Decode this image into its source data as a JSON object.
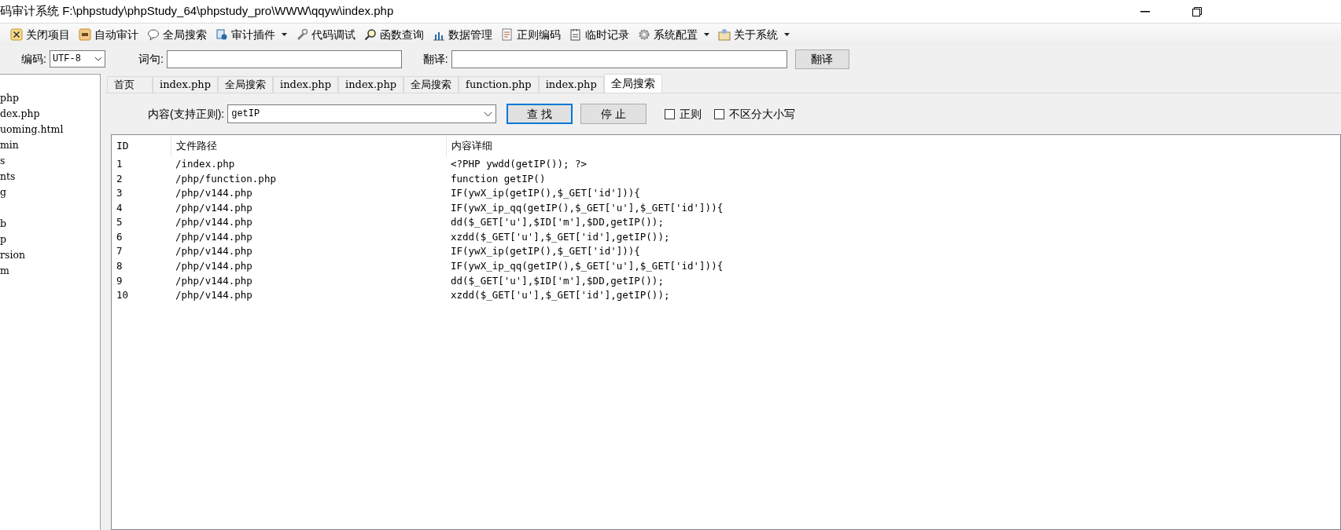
{
  "window": {
    "title": "码审计系统  F:\\phpstudy\\phpStudy_64\\phpstudy_pro\\WWW\\qqyw\\index.php"
  },
  "toolbar": [
    {
      "label": "关闭项目",
      "dropdown": false
    },
    {
      "label": "自动审计",
      "dropdown": false
    },
    {
      "label": "全局搜索",
      "dropdown": false
    },
    {
      "label": "审计插件",
      "dropdown": true
    },
    {
      "label": "代码调试",
      "dropdown": false
    },
    {
      "label": "函数查询",
      "dropdown": false
    },
    {
      "label": "数据管理",
      "dropdown": false
    },
    {
      "label": "正则编码",
      "dropdown": false
    },
    {
      "label": "临时记录",
      "dropdown": false
    },
    {
      "label": "系统配置",
      "dropdown": true
    },
    {
      "label": "关于系统",
      "dropdown": true
    }
  ],
  "fields_row": {
    "encoding_label": "编码:",
    "encoding_value": "UTF-8",
    "phrase_label": "词句:",
    "translate_label": "翻译:",
    "translate_button": "翻译"
  },
  "tree": {
    "items": [
      "php",
      "dex.php",
      "uoming.html",
      "min",
      "s",
      "nts",
      "g",
      "b",
      "p",
      "rsion",
      "m"
    ]
  },
  "tabs": [
    {
      "label": "首页",
      "selected": false
    },
    {
      "label": "index.php",
      "selected": false
    },
    {
      "label": "全局搜索",
      "selected": false
    },
    {
      "label": "index.php",
      "selected": false
    },
    {
      "label": "index.php",
      "selected": false
    },
    {
      "label": "全局搜索",
      "selected": false
    },
    {
      "label": "function.php",
      "selected": false
    },
    {
      "label": "index.php",
      "selected": false
    },
    {
      "label": "全局搜索",
      "selected": true
    }
  ],
  "search": {
    "label": "内容(支持正则):",
    "value": "getIP",
    "find_button": "查 找",
    "stop_button": "停 止",
    "options": [
      {
        "label": "正则",
        "checked": false
      },
      {
        "label": "不区分大小写",
        "checked": false
      }
    ]
  },
  "table": {
    "columns": [
      "ID",
      "文件路径",
      "内容详细"
    ],
    "rows": [
      [
        "1",
        "/index.php",
        "<?PHP  ywdd(getIP()); ?>"
      ],
      [
        "2",
        "/php/function.php",
        "function getIP()"
      ],
      [
        "3",
        "/php/v144.php",
        "IF(ywX_ip(getIP(),$_GET['id'])){"
      ],
      [
        "4",
        "/php/v144.php",
        "IF(ywX_ip_qq(getIP(),$_GET['u'],$_GET['id'])){"
      ],
      [
        "5",
        "/php/v144.php",
        "dd($_GET['u'],$ID['m'],$DD,getIP());"
      ],
      [
        "6",
        "/php/v144.php",
        "xzdd($_GET['u'],$_GET['id'],getIP());"
      ],
      [
        "7",
        "/php/v144.php",
        "IF(ywX_ip(getIP(),$_GET['id'])){"
      ],
      [
        "8",
        "/php/v144.php",
        "IF(ywX_ip_qq(getIP(),$_GET['u'],$_GET['id'])){"
      ],
      [
        "9",
        "/php/v144.php",
        "dd($_GET['u'],$ID['m'],$DD,getIP());"
      ],
      [
        "10",
        "/php/v144.php",
        "xzdd($_GET['u'],$_GET['id'],getIP());"
      ]
    ]
  }
}
